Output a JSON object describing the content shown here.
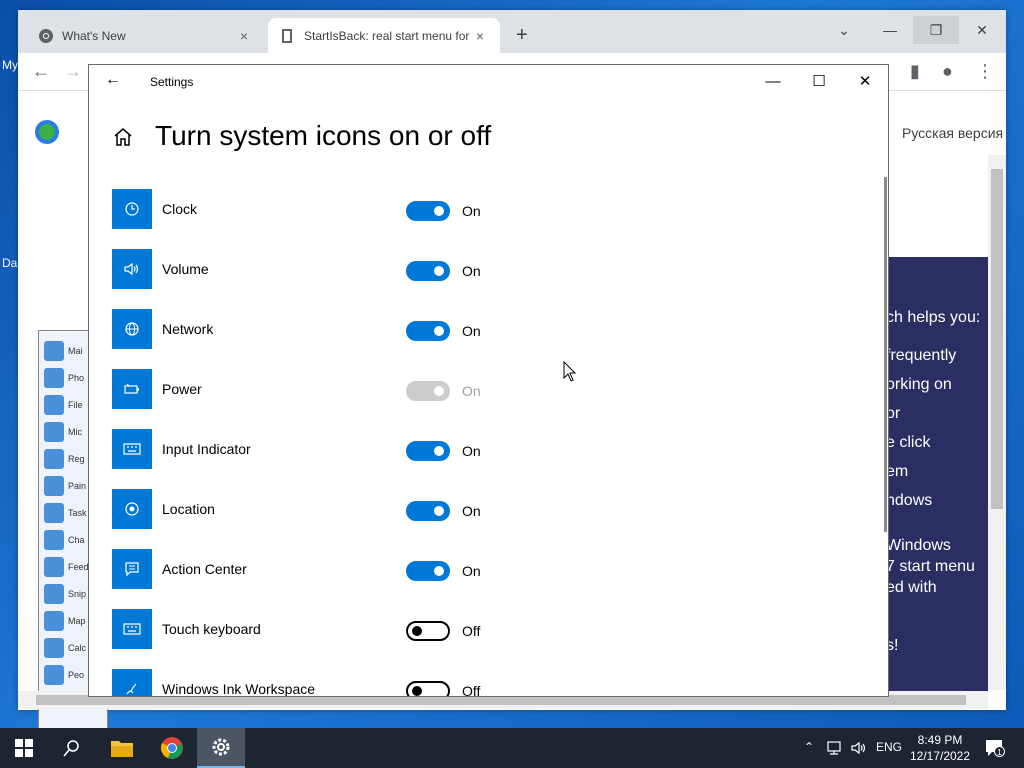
{
  "desktop": {
    "label_my": "My",
    "label_da": "Da"
  },
  "browser": {
    "tabs": [
      {
        "title": "What's New",
        "close": "×"
      },
      {
        "title": "StartIsBack: real start menu for Wi",
        "close": "×"
      }
    ],
    "new_tab": "+",
    "page": {
      "language_link": "Русская версия",
      "promo_lines": [
        "ch helps you:",
        "frequently",
        "orking on",
        "or",
        "e click",
        "em",
        "ndows",
        "Windows",
        "7 start menu",
        "ed with",
        "s!"
      ],
      "menu_items": [
        "Mai",
        "Pho",
        "File",
        "Mic",
        "Reg",
        "Pain",
        "Task",
        "Cha",
        "Feed",
        "Snip",
        "Map",
        "Calc",
        "Peo"
      ]
    }
  },
  "settings": {
    "window_title": "Settings",
    "heading": "Turn system icons on or off",
    "items": [
      {
        "label": "Clock",
        "state": "On",
        "icon": "clock-icon",
        "mode": "on"
      },
      {
        "label": "Volume",
        "state": "On",
        "icon": "volume-icon",
        "mode": "on"
      },
      {
        "label": "Network",
        "state": "On",
        "icon": "network-icon",
        "mode": "on"
      },
      {
        "label": "Power",
        "state": "On",
        "icon": "power-icon",
        "mode": "disabled"
      },
      {
        "label": "Input Indicator",
        "state": "On",
        "icon": "keyboard-icon",
        "mode": "on"
      },
      {
        "label": "Location",
        "state": "On",
        "icon": "location-icon",
        "mode": "on"
      },
      {
        "label": "Action Center",
        "state": "On",
        "icon": "action-center-icon",
        "mode": "on"
      },
      {
        "label": "Touch keyboard",
        "state": "Off",
        "icon": "touch-keyboard-icon",
        "mode": "off"
      },
      {
        "label": "Windows Ink Workspace",
        "state": "Off",
        "icon": "pen-icon",
        "mode": "off"
      }
    ],
    "accent_color": "#0078d7"
  },
  "taskbar": {
    "language": "ENG",
    "time": "8:49 PM",
    "date": "12/17/2022",
    "notification_count": "1"
  }
}
